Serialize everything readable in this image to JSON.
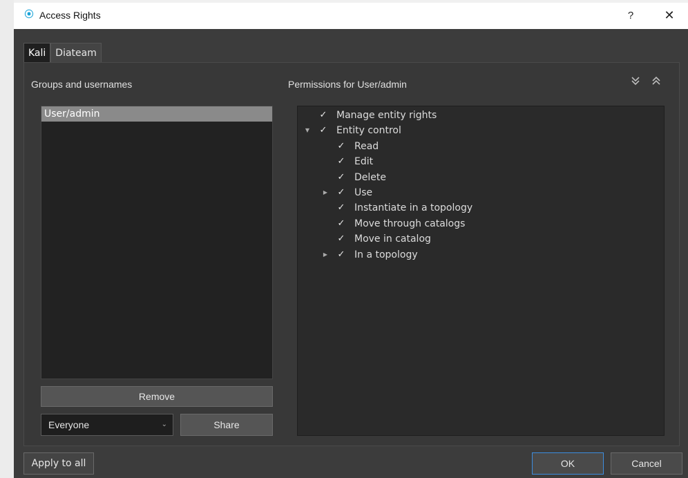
{
  "window": {
    "title": "Access Rights",
    "app_icon": "app-logo-icon",
    "help_label": "?",
    "close_label": "✕"
  },
  "tabs": [
    {
      "label": "Kali",
      "active": true
    },
    {
      "label": "Diateam",
      "active": false
    }
  ],
  "groups": {
    "label": "Groups and usernames",
    "items": [
      "User/admin"
    ],
    "selected": "User/admin",
    "remove_label": "Remove",
    "select_value": "Everyone",
    "share_label": "Share"
  },
  "permissions": {
    "label": "Permissions for User/admin",
    "expand_icon": "double-chevron-down-icon",
    "collapse_icon": "double-chevron-up-icon",
    "tree": [
      {
        "label": "Manage entity rights",
        "checked": true,
        "level": 0,
        "expander": "none"
      },
      {
        "label": "Entity control",
        "checked": true,
        "level": 0,
        "expander": "expanded"
      },
      {
        "label": "Read",
        "checked": true,
        "level": 1,
        "expander": "none"
      },
      {
        "label": "Edit",
        "checked": true,
        "level": 1,
        "expander": "none"
      },
      {
        "label": "Delete",
        "checked": true,
        "level": 1,
        "expander": "none"
      },
      {
        "label": "Use",
        "checked": true,
        "level": 1,
        "expander": "collapsed"
      },
      {
        "label": "Instantiate in a topology",
        "checked": true,
        "level": 1,
        "expander": "none"
      },
      {
        "label": "Move through catalogs",
        "checked": true,
        "level": 1,
        "expander": "none"
      },
      {
        "label": "Move in catalog",
        "checked": true,
        "level": 1,
        "expander": "none"
      },
      {
        "label": "In a topology",
        "checked": true,
        "level": 1,
        "expander": "collapsed"
      }
    ]
  },
  "footer": {
    "apply_all_label": "Apply to all",
    "ok_label": "OK",
    "cancel_label": "Cancel"
  },
  "colors": {
    "background": "#3c3c3c",
    "list_background": "#222222",
    "selection": "#8a8a8a",
    "accent": "#3d8ee0",
    "app_icon": "#1aa3d8"
  }
}
